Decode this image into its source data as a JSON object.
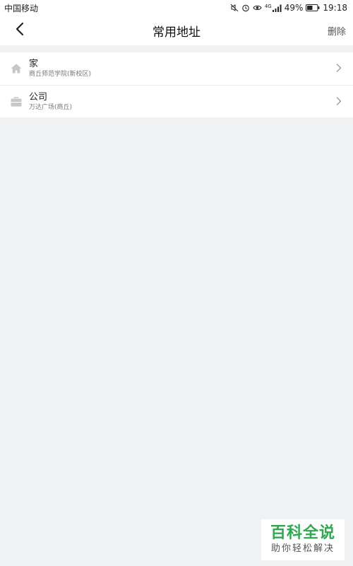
{
  "status_bar": {
    "carrier": "中国移动",
    "network": "4G",
    "battery_percent": "49%",
    "time": "19:18"
  },
  "nav": {
    "title": "常用地址",
    "delete_label": "删除"
  },
  "addresses": [
    {
      "name": "家",
      "detail": "商丘师范学院(新校区)",
      "icon": "home-icon"
    },
    {
      "name": "公司",
      "detail": "万达广场(商丘)",
      "icon": "briefcase-icon"
    }
  ],
  "watermark": {
    "title": "百科全说",
    "subtitle": "助你轻松解决"
  },
  "colors": {
    "background": "#f0f1f3",
    "surface": "#ffffff",
    "icon_gray": "#c7c7c7",
    "watermark_green": "#2fa84f"
  }
}
